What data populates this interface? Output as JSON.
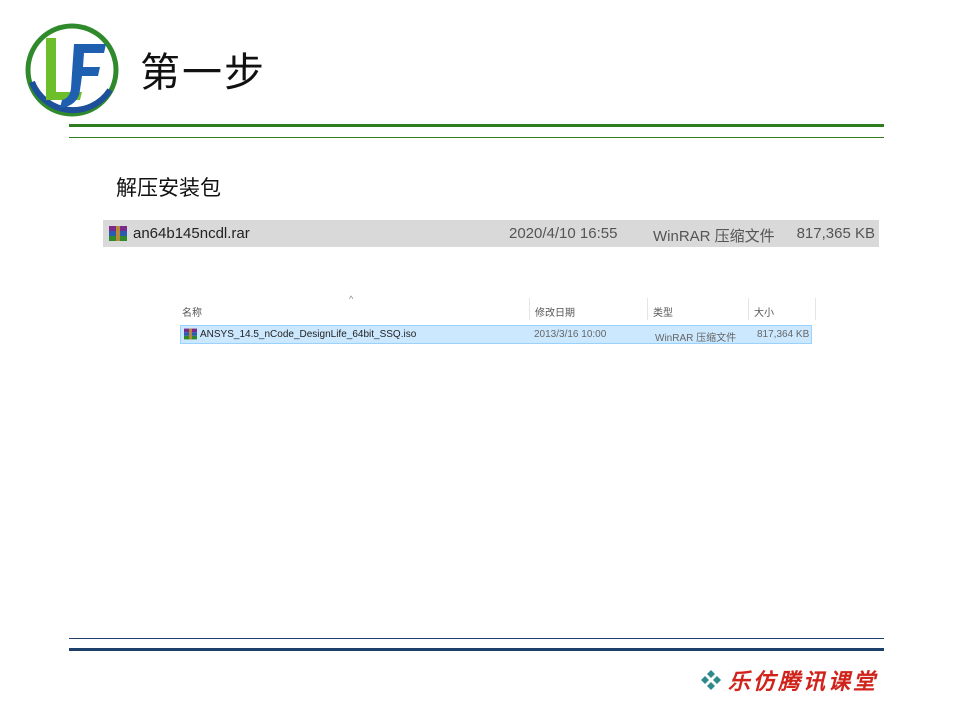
{
  "slide": {
    "title": "第一步",
    "subtitle": "解压安装包",
    "brand": "乐仿腾讯课堂",
    "colors": {
      "green_rule": "#2f7d1e",
      "blue_rule": "#1f3f6b",
      "brand_red": "#d0231b",
      "selection": "#cce8ff"
    }
  },
  "archive_row": {
    "icon": "winrar-archive-icon",
    "name": "an64b145ncdl.rar",
    "modified": "2020/4/10 16:55",
    "type": "WinRAR 压缩文件",
    "size": "817,365 KB"
  },
  "explorer": {
    "columns": {
      "name": "名称",
      "modified": "修改日期",
      "type": "类型",
      "size": "大小"
    },
    "rows": [
      {
        "icon": "winrar-archive-icon",
        "name": "ANSYS_14.5_nCode_DesignLife_64bit_SSQ.iso",
        "modified": "2013/3/16 10:00",
        "type": "WinRAR 压缩文件",
        "size": "817,364 KB",
        "selected": true
      }
    ]
  }
}
